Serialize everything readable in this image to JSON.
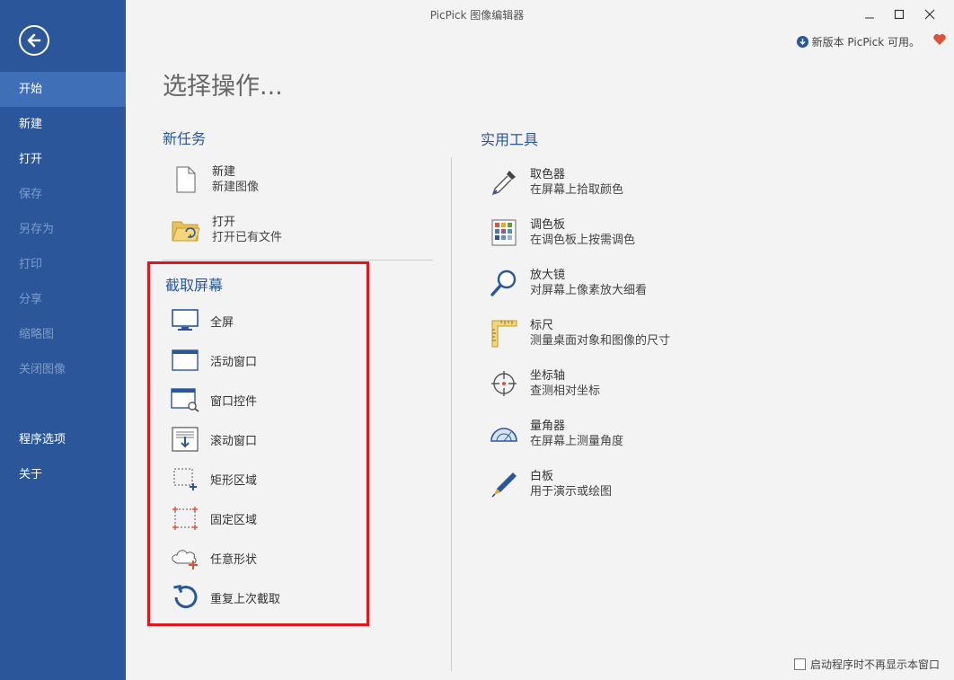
{
  "window": {
    "title": "PicPick 图像编辑器"
  },
  "sidebar": {
    "items": [
      {
        "label": "开始",
        "state": "active"
      },
      {
        "label": "新建",
        "state": "enabled"
      },
      {
        "label": "打开",
        "state": "enabled"
      },
      {
        "label": "保存",
        "state": "disabled"
      },
      {
        "label": "另存为",
        "state": "disabled"
      },
      {
        "label": "打印",
        "state": "disabled"
      },
      {
        "label": "分享",
        "state": "disabled"
      },
      {
        "label": "缩略图",
        "state": "disabled"
      },
      {
        "label": "关闭图像",
        "state": "disabled"
      }
    ],
    "bottom_items": [
      {
        "label": "程序选项"
      },
      {
        "label": "关于"
      }
    ]
  },
  "update": {
    "text": "新版本 PicPick 可用。"
  },
  "main": {
    "title": "选择操作...",
    "new_task": {
      "title": "新任务",
      "items": [
        {
          "label": "新建",
          "sub": "新建图像",
          "icon": "new-file-icon"
        },
        {
          "label": "打开",
          "sub": "打开已有文件",
          "icon": "open-folder-icon"
        }
      ]
    },
    "capture": {
      "title": "截取屏幕",
      "items": [
        {
          "label": "全屏",
          "icon": "monitor-icon"
        },
        {
          "label": "活动窗口",
          "icon": "window-icon"
        },
        {
          "label": "窗口控件",
          "icon": "window-control-icon"
        },
        {
          "label": "滚动窗口",
          "icon": "scroll-window-icon"
        },
        {
          "label": "矩形区域",
          "icon": "rect-region-icon"
        },
        {
          "label": "固定区域",
          "icon": "fixed-region-icon"
        },
        {
          "label": "任意形状",
          "icon": "freehand-icon"
        },
        {
          "label": "重复上次截取",
          "icon": "repeat-icon"
        }
      ]
    },
    "tools": {
      "title": "实用工具",
      "items": [
        {
          "label": "取色器",
          "sub": "在屏幕上拾取颜色",
          "icon": "eyedropper-icon"
        },
        {
          "label": "调色板",
          "sub": "在调色板上按需调色",
          "icon": "palette-icon"
        },
        {
          "label": "放大镜",
          "sub": "对屏幕上像素放大细看",
          "icon": "magnifier-icon"
        },
        {
          "label": "标尺",
          "sub": "测量桌面对象和图像的尺寸",
          "icon": "ruler-icon"
        },
        {
          "label": "坐标轴",
          "sub": "查测相对坐标",
          "icon": "crosshair-icon"
        },
        {
          "label": "量角器",
          "sub": "在屏幕上测量角度",
          "icon": "protractor-icon"
        },
        {
          "label": "白板",
          "sub": "用于演示或绘图",
          "icon": "pen-icon"
        }
      ]
    }
  },
  "footer": {
    "startup_checkbox": "启动程序时不再显示本窗口",
    "checked": false
  },
  "colors": {
    "sidebar": "#2b579a",
    "sidebar_active": "#3f6fb7",
    "highlight": "#e0161c",
    "accent": "#2b579a"
  }
}
